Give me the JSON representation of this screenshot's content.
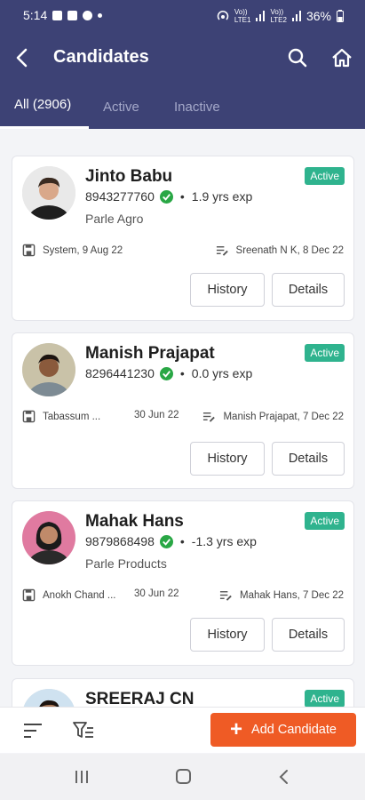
{
  "status_bar": {
    "time": "5:14",
    "signal_text": "Vo))\nLTE1",
    "signal_text2": "Vo))\nLTE2",
    "battery": "36%"
  },
  "app_bar": {
    "title": "Candidates"
  },
  "tabs": [
    {
      "label": "All (2906)",
      "selected": true
    },
    {
      "label": "Active",
      "selected": false
    },
    {
      "label": "Inactive",
      "selected": false
    }
  ],
  "colors": {
    "header": "#3d4275",
    "badge": "#2fb38e",
    "primary_button": "#ef5b25",
    "verified": "#29a745"
  },
  "candidates": [
    {
      "name": "Jinto Babu",
      "phone": "8943277760",
      "experience": "1.9 yrs exp",
      "company": "Parle Agro",
      "status": "Active",
      "created_by": "System, 9 Aug 22",
      "created_date": "",
      "updated_by": "Sreenath N K, 8 Dec 22",
      "history_label": "History",
      "details_label": "Details"
    },
    {
      "name": "Manish Prajapat",
      "phone": "8296441230",
      "experience": "0.0 yrs exp",
      "company": "",
      "status": "Active",
      "created_by": "Tabassum ...",
      "created_date": "30 Jun 22",
      "updated_by": "Manish Prajapat, 7 Dec 22",
      "history_label": "History",
      "details_label": "Details"
    },
    {
      "name": "Mahak Hans",
      "phone": "9879868498",
      "experience": "-1.3 yrs exp",
      "company": "Parle Products",
      "status": "Active",
      "created_by": "Anokh Chand ...",
      "created_date": "30 Jun 22",
      "updated_by": "Mahak Hans, 7 Dec 22",
      "history_label": "History",
      "details_label": "Details"
    },
    {
      "name": "SREERAJ CN",
      "status": "Active"
    }
  ],
  "bottom_bar": {
    "add_button_label": "Add Candidate",
    "sort_icon": "sort-icon",
    "filter_icon": "filter-icon"
  },
  "nav": {
    "recents": "recents-icon",
    "home": "home-circle-icon",
    "back": "back-chevron-icon"
  }
}
